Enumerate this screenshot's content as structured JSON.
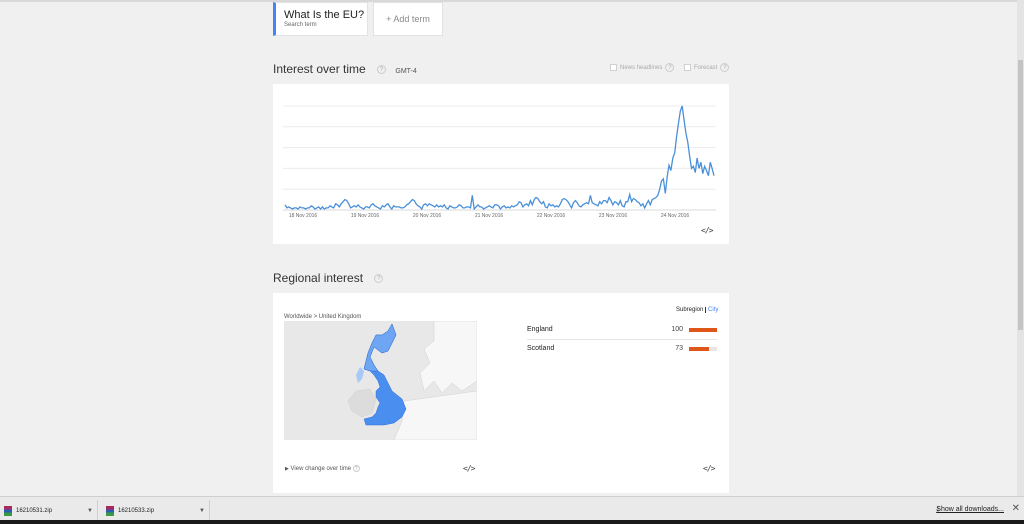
{
  "search": {
    "term": "What Is the EU?",
    "term_type": "Search term",
    "add_term": "+ Add term"
  },
  "interest": {
    "title": "Interest over time",
    "help": "?",
    "timezone": "GMT-4",
    "news_headlines": "News headlines",
    "forecast": "Forecast",
    "embed": "</>"
  },
  "chart_data": {
    "type": "line",
    "x_ticks": [
      "18 Nov 2016",
      "19 Nov 2016",
      "20 Nov 2016",
      "21 Nov 2016",
      "22 Nov 2016",
      "23 Nov 2016",
      "24 Nov 2016"
    ],
    "ylim": [
      0,
      100
    ],
    "grid": true,
    "color": "#4a90d9",
    "series": [
      {
        "values": [
          5,
          2,
          3,
          2,
          1,
          2,
          2,
          1,
          3,
          2,
          2,
          1,
          2,
          2,
          4,
          3,
          1,
          2,
          3,
          1,
          3,
          1,
          2,
          2,
          4,
          3,
          2,
          6,
          5,
          3,
          6,
          8,
          10,
          9,
          6,
          2,
          3,
          4,
          3,
          5,
          3,
          2,
          1,
          3,
          3,
          2,
          5,
          6,
          4,
          3,
          2,
          1,
          4,
          3,
          5,
          6,
          3,
          1,
          4,
          3,
          3,
          3,
          2,
          2,
          3,
          5,
          6,
          8,
          10,
          9,
          6,
          4,
          3,
          1,
          5,
          6,
          4,
          6,
          5,
          4,
          3,
          5,
          3,
          4,
          3,
          5,
          2,
          1,
          4,
          3,
          2,
          2,
          3,
          5,
          4,
          2,
          2,
          3,
          3,
          2,
          14,
          1,
          3,
          5,
          3,
          3,
          1,
          2,
          3,
          4,
          3,
          2,
          5,
          5,
          4,
          1,
          3,
          4,
          2,
          3,
          2,
          4,
          3,
          4,
          5,
          8,
          7,
          3,
          5,
          6,
          4,
          9,
          5,
          10,
          12,
          11,
          8,
          6,
          8,
          3,
          2,
          6,
          4,
          5,
          3,
          4,
          3,
          6,
          10,
          11,
          10,
          8,
          5,
          2,
          7,
          9,
          7,
          4,
          3,
          5,
          6,
          7,
          6,
          14,
          7,
          6,
          5,
          4,
          8,
          6,
          9,
          9,
          7,
          12,
          9,
          5,
          8,
          7,
          5,
          9,
          4,
          3,
          8,
          8,
          15,
          8,
          11,
          10,
          8,
          7,
          4,
          6,
          2,
          6,
          9,
          5,
          10,
          11,
          12,
          14,
          20,
          28,
          30,
          16,
          32,
          43,
          38,
          50,
          55,
          70,
          83,
          95,
          100,
          87,
          74,
          65,
          52,
          40,
          42,
          36,
          50,
          40,
          46,
          35,
          42,
          38,
          33,
          46,
          40,
          33
        ]
      }
    ]
  },
  "regional": {
    "title": "Regional interest",
    "help": "?",
    "breadcrumb": "Worldwide > United Kingdom",
    "subregion": "Subregion",
    "city": "City",
    "view_change": "View change over time",
    "embed_left": "</>",
    "embed_right": "</>",
    "rows": [
      {
        "name": "England",
        "value": 100,
        "fraction": 1.0
      },
      {
        "name": "Scotland",
        "value": 73,
        "fraction": 0.73
      }
    ],
    "bar_color": "#e0561a"
  },
  "downloads": {
    "items": [
      {
        "name": "16210531.zip"
      },
      {
        "name": "16210533.zip"
      }
    ],
    "show_all": "Show all downloads..."
  }
}
